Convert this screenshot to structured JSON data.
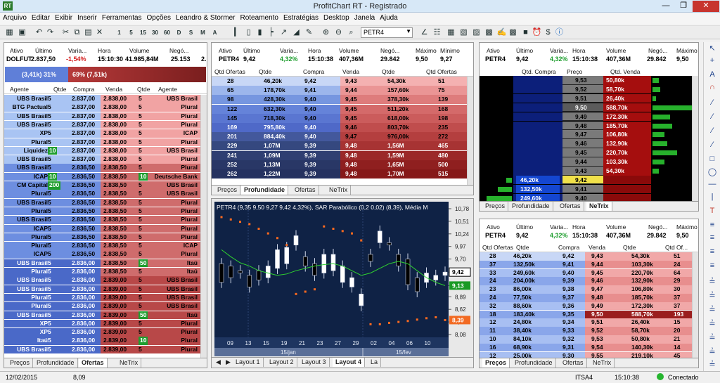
{
  "window": {
    "title": "ProfitChart RT - Registrado",
    "app_icon": "RT"
  },
  "menu": [
    "Arquivo",
    "Editar",
    "Exibir",
    "Inserir",
    "Ferramentas",
    "Opções",
    "Leandro & Stormer",
    "Roteamento",
    "Estratégias",
    "Desktop",
    "Janela",
    "Ajuda"
  ],
  "toolbar": {
    "ticker": "PETR4",
    "period_buttons": [
      "1",
      "5",
      "15",
      "30",
      "60",
      "D",
      "S",
      "M",
      "A"
    ]
  },
  "p1": {
    "headers": [
      "Ativo",
      "Último",
      "Varia...",
      "Hora",
      "Volume",
      "Negó..."
    ],
    "values": [
      "DOLFUT",
      "2.837,50",
      "-1,54%",
      "15:10:30",
      "41.985,84M",
      "25.153",
      "2."
    ],
    "buy_bar": "(3,41k) 31%",
    "sell_bar": "69% (7,51k)",
    "book_headers": [
      "Agente",
      "Qtde",
      "Compra",
      "Venda",
      "Qtde",
      "Agente"
    ],
    "rows": [
      [
        "UBS Brasil",
        "5",
        "2.837,00",
        "2.838,00",
        "5",
        "UBS Brasil"
      ],
      [
        "BTG Pactual",
        "5",
        "2.837,00",
        "2.838,00",
        "5",
        "Plural"
      ],
      [
        "UBS Brasil",
        "5",
        "2.837,00",
        "2.838,00",
        "5",
        "Plural"
      ],
      [
        "UBS Brasil",
        "5",
        "2.837,00",
        "2.838,00",
        "5",
        "Plural"
      ],
      [
        "XP",
        "5",
        "2.837,00",
        "2.838,00",
        "5",
        "ICAP"
      ],
      [
        "Plural",
        "5",
        "2.837,00",
        "2.838,00",
        "5",
        "Plural"
      ],
      [
        "Liquidez",
        "10",
        "2.837,00",
        "2.838,00",
        "5",
        "UBS Brasil"
      ],
      [
        "UBS Brasil",
        "5",
        "2.837,00",
        "2.838,00",
        "5",
        "Plural"
      ],
      [
        "UBS Brasil",
        "5",
        "2.836,50",
        "2.838,50",
        "5",
        "Plural"
      ],
      [
        "ICAP",
        "10",
        "2.836,50",
        "2.838,50",
        "10",
        "Deutsche Bank"
      ],
      [
        "CM Capital",
        "200",
        "2.836,50",
        "2.838,50",
        "5",
        "UBS Brasil"
      ],
      [
        "Plural",
        "5",
        "2.836,50",
        "2.838,50",
        "5",
        "UBS Brasil"
      ],
      [
        "UBS Brasil",
        "5",
        "2.836,50",
        "2.838,50",
        "5",
        "Plural"
      ],
      [
        "Plural",
        "5",
        "2.836,50",
        "2.838,50",
        "5",
        "Plural"
      ],
      [
        "UBS Brasil",
        "5",
        "2.836,50",
        "2.838,50",
        "5",
        "Plural"
      ],
      [
        "ICAP",
        "5",
        "2.836,50",
        "2.838,50",
        "5",
        "Plural"
      ],
      [
        "Plural",
        "5",
        "2.836,50",
        "2.838,50",
        "5",
        "Plural"
      ],
      [
        "Plural",
        "5",
        "2.836,50",
        "2.838,50",
        "5",
        "ICAP"
      ],
      [
        "ICAP",
        "5",
        "2.836,50",
        "2.838,50",
        "5",
        "Plural"
      ],
      [
        "UBS Brasil",
        "5",
        "2.836,00",
        "2.838,50",
        "50",
        "Itaú"
      ],
      [
        "Plural",
        "5",
        "2.836,00",
        "2.838,50",
        "5",
        "Itaú"
      ],
      [
        "UBS Brasil",
        "5",
        "2.836,00",
        "2.839,00",
        "5",
        "UBS Brasil"
      ],
      [
        "UBS Brasil",
        "5",
        "2.836,00",
        "2.839,00",
        "5",
        "UBS Brasil"
      ],
      [
        "Plural",
        "5",
        "2.836,00",
        "2.839,00",
        "5",
        "UBS Brasil"
      ],
      [
        "Plural",
        "5",
        "2.836,00",
        "2.839,00",
        "5",
        "UBS Brasil"
      ],
      [
        "UBS Brasil",
        "5",
        "2.836,00",
        "2.839,00",
        "50",
        "Itaú"
      ],
      [
        "XP",
        "5",
        "2.836,00",
        "2.839,00",
        "5",
        "Plural"
      ],
      [
        "XP",
        "5",
        "2.836,00",
        "2.839,00",
        "5",
        "Plural"
      ],
      [
        "Itaú",
        "5",
        "2.836,00",
        "2.839,00",
        "10",
        "Plural"
      ],
      [
        "UBS Brasil",
        "5",
        "2.836,00",
        "2.839,00",
        "5",
        "Plural"
      ]
    ],
    "tabs": [
      "Preços",
      "Profundidade",
      "Ofertas",
      "NeTrix"
    ],
    "active_tab": "Ofertas"
  },
  "p2": {
    "headers": [
      "Ativo",
      "Último",
      "Varia...",
      "Hora",
      "Volume",
      "Negó...",
      "Máximo",
      "Mínimo"
    ],
    "values": [
      "PETR4",
      "9,42",
      "4,32%",
      "15:10:38",
      "407,36M",
      "29.842",
      "9,50",
      "9,27"
    ],
    "book_headers": [
      "Qtd Ofertas",
      "Qtde",
      "Compra",
      "Venda",
      "Qtde",
      "Qtd Ofertas"
    ],
    "rows": [
      [
        "28",
        "46,20k",
        "9,42",
        "9,43",
        "54,30k",
        "51"
      ],
      [
        "65",
        "178,70k",
        "9,41",
        "9,44",
        "157,60k",
        "75"
      ],
      [
        "98",
        "428,30k",
        "9,40",
        "9,45",
        "378,30k",
        "139"
      ],
      [
        "122",
        "632,30k",
        "9,40",
        "9,45",
        "511,20k",
        "168"
      ],
      [
        "145",
        "718,30k",
        "9,40",
        "9,45",
        "618,00k",
        "198"
      ],
      [
        "169",
        "795,80k",
        "9,40",
        "9,46",
        "803,70k",
        "235"
      ],
      [
        "201",
        "884,40k",
        "9,40",
        "9,47",
        "976,00k",
        "272"
      ],
      [
        "229",
        "1,07M",
        "9,39",
        "9,48",
        "1,56M",
        "465"
      ],
      [
        "241",
        "1,09M",
        "9,39",
        "9,48",
        "1,59M",
        "480"
      ],
      [
        "252",
        "1,13M",
        "9,39",
        "9,48",
        "1,65M",
        "500"
      ],
      [
        "262",
        "1,22M",
        "9,39",
        "9,48",
        "1,70M",
        "515"
      ]
    ],
    "tabs": [
      "Preços",
      "Profundidade",
      "Ofertas",
      "NeTrix"
    ],
    "active_tab": "Profundidade"
  },
  "p3": {
    "headers": [
      "Ativo",
      "Último",
      "Varia...",
      "Hora",
      "Volume",
      "Negó...",
      "Máximo"
    ],
    "values": [
      "PETR4",
      "9,42",
      "4,32%",
      "15:10:38",
      "407,36M",
      "29.842",
      "9,50"
    ],
    "col_headers": [
      "Qtd. Compra",
      "Preço",
      "Qtd. Venda"
    ],
    "prices": [
      "9,53",
      "9,52",
      "9,51",
      "9,50",
      "9,49",
      "9,48",
      "9,47",
      "9,46",
      "9,45",
      "9,44",
      "9,43",
      "9,42",
      "9,41",
      "9,40"
    ],
    "sell": [
      "50,80k",
      "58,70k",
      "26,40k",
      "588,70k",
      "172,30k",
      "185,70k",
      "106,80k",
      "132,90k",
      "220,70k",
      "103,30k",
      "54,30k",
      "",
      "",
      ""
    ],
    "buy": [
      "",
      "",
      "",
      "",
      "",
      "",
      "",
      "",
      "",
      "",
      "",
      "46,20k",
      "132,50k",
      "249,60k"
    ],
    "tabs": [
      "Preços",
      "Profundidade",
      "Ofertas",
      "NeTrix"
    ],
    "active_tab": "NeTrix"
  },
  "chart": {
    "legend": "PETR4 (9,35  9,50  9,27  9,42  4,32%), SAR Parabólico (0,2 0,02) (8,39), Média M",
    "y_ticks": [
      "10,78",
      "10,51",
      "10,24",
      "9,97",
      "9,70",
      "9,42",
      "9,13",
      "8,89",
      "8,62",
      "8,35",
      "8,08"
    ],
    "last_price": "9,42",
    "ma_label": "9,13",
    "sar_label": "8,39",
    "x_ticks": [
      "09",
      "13",
      "15",
      "19",
      "21",
      "23",
      "27",
      "29",
      "02",
      "04",
      "06",
      "10"
    ],
    "x_periods": [
      "15/jan",
      "15/fev"
    ],
    "tabs": [
      "Layout 1",
      "Layout 2",
      "Layout 3",
      "Layout 4",
      "La"
    ],
    "active_tab": "Layout 4",
    "colors": {
      "bg": "#0f2245",
      "up": "#ffffff",
      "down": "#000000",
      "ma": "#2fd12f",
      "sar": "#ff6a1f"
    }
  },
  "chart_data": {
    "type": "candlestick",
    "title": "",
    "xlabel": "",
    "ylabel": "",
    "ylim": [
      8.08,
      10.78
    ],
    "x": [
      "09",
      "12",
      "13",
      "14",
      "15",
      "16",
      "19",
      "20",
      "21",
      "22",
      "23",
      "26",
      "27",
      "28",
      "29",
      "30",
      "02",
      "03",
      "04",
      "05",
      "06",
      "09",
      "10",
      "11",
      "12"
    ],
    "open": [
      9.6,
      9.55,
      9.45,
      9.35,
      9.45,
      9.3,
      9.5,
      9.6,
      10.0,
      9.75,
      9.6,
      9.4,
      9.45,
      9.2,
      9.1,
      8.7,
      9.8,
      10.05,
      10.05,
      9.8,
      9.7,
      9.3,
      9.2,
      9.25,
      9.35
    ],
    "close": [
      9.2,
      9.3,
      9.4,
      9.1,
      9.25,
      9.55,
      9.9,
      9.95,
      10.2,
      9.55,
      9.35,
      9.8,
      9.8,
      9.55,
      9.3,
      8.95,
      9.65,
      10.3,
      10.0,
      9.55,
      9.15,
      9.0,
      9.4,
      9.35,
      9.42
    ],
    "ma": [
      9.9,
      9.75,
      9.62,
      9.55,
      9.45,
      9.4,
      9.35,
      9.38,
      9.45,
      9.5,
      9.55,
      9.58,
      9.6,
      9.55,
      9.45,
      9.35,
      9.4,
      9.5,
      9.6,
      9.65,
      9.6,
      9.45,
      9.3,
      9.2,
      9.13
    ],
    "sar": [
      10.6,
      10.55,
      10.5,
      10.45,
      10.35,
      10.25,
      10.15,
      10.0,
      8.95,
      9.0,
      9.05,
      10.4,
      10.35,
      10.3,
      10.25,
      10.1,
      8.3,
      8.3,
      8.33,
      8.35,
      8.37,
      8.4,
      8.43,
      8.45,
      8.39
    ]
  },
  "p4": {
    "headers": [
      "Ativo",
      "Último",
      "Varia...",
      "Hora",
      "Volume",
      "Negó...",
      "Máximo"
    ],
    "values": [
      "PETR4",
      "9,42",
      "4,32%",
      "15:10:38",
      "407,36M",
      "29.842",
      "9,50"
    ],
    "book_headers": [
      "Qtd Ofertas",
      "Qtde",
      "Compra",
      "Venda",
      "Qtde",
      "Qtd Of..."
    ],
    "rows": [
      [
        "28",
        "46,20k",
        "9,42",
        "9,43",
        "54,30k",
        "51"
      ],
      [
        "37",
        "132,50k",
        "9,41",
        "9,44",
        "103,30k",
        "24"
      ],
      [
        "33",
        "249,60k",
        "9,40",
        "9,45",
        "220,70k",
        "64"
      ],
      [
        "24",
        "204,00k",
        "9,39",
        "9,46",
        "132,90k",
        "29"
      ],
      [
        "23",
        "86,00k",
        "9,38",
        "9,47",
        "106,80k",
        "30"
      ],
      [
        "24",
        "77,50k",
        "9,37",
        "9,48",
        "185,70k",
        "37"
      ],
      [
        "32",
        "88,60k",
        "9,36",
        "9,49",
        "172,30k",
        "37"
      ],
      [
        "18",
        "183,40k",
        "9,35",
        "9,50",
        "588,70k",
        "193"
      ],
      [
        "12",
        "24,80k",
        "9,34",
        "9,51",
        "26,40k",
        "15"
      ],
      [
        "11",
        "38,40k",
        "9,33",
        "9,52",
        "58,70k",
        "20"
      ],
      [
        "10",
        "84,10k",
        "9,32",
        "9,53",
        "50,80k",
        "21"
      ],
      [
        "16",
        "68,90k",
        "9,31",
        "9,54",
        "140,30k",
        "14"
      ],
      [
        "12",
        "25,00k",
        "9,30",
        "9,55",
        "219,10k",
        "45"
      ]
    ],
    "tabs": [
      "Preços",
      "Profundidade",
      "Ofertas",
      "NeTrix"
    ],
    "active_tab": "Preços"
  },
  "status": {
    "date": "12/02/2015",
    "value": "8,09",
    "asset": "ITSA4",
    "time": "15:10:38",
    "conn": "Conectado"
  }
}
